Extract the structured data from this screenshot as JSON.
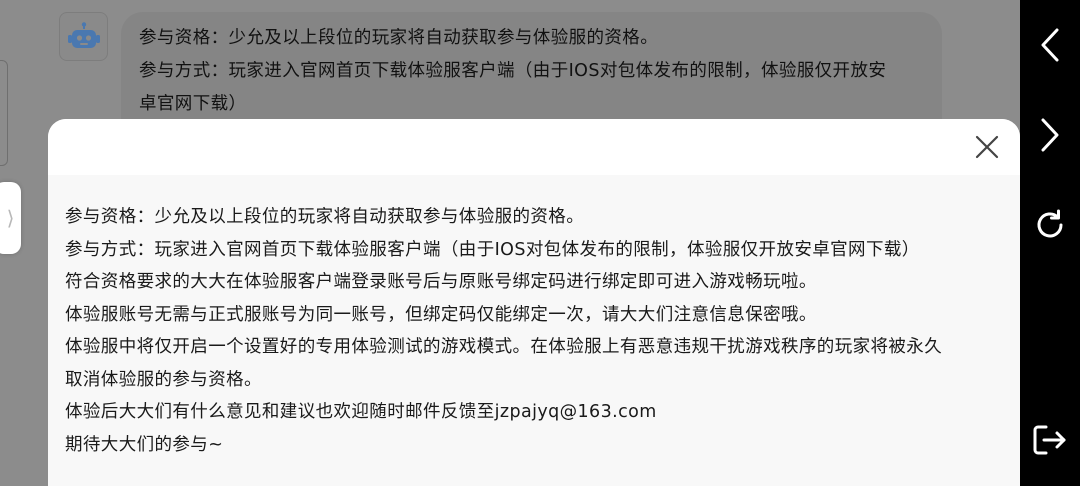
{
  "chat": {
    "bubble_lines": [
      "参与资格：少允及以上段位的玩家将自动获取参与体验服的资格。",
      "参与方式：玩家进入官网首页下载体验服客户端（由于IOS对包体发布的限制，体验服仅开放安",
      "卓官网下载）"
    ]
  },
  "modal": {
    "lines": [
      "参与资格：少允及以上段位的玩家将自动获取参与体验服的资格。",
      "参与方式：玩家进入官网首页下载体验服客户端（由于IOS对包体发布的限制，体验服仅开放安卓官网下载）",
      "符合资格要求的大大在体验服客户端登录账号后与原账号绑定码进行绑定即可进入游戏畅玩啦。",
      "体验服账号无需与正式服账号为同一账号，但绑定码仅能绑定一次，请大大们注意信息保密哦。",
      "体验服中将仅开启一个设置好的专用体验测试的游戏模式。在体验服上有恶意违规干扰游戏秩序的玩家将被永久",
      "取消体验服的参与资格。",
      "体验后大大们有什么意见和建议也欢迎随时邮件反馈至jzpajyq@163.com",
      "期待大大们的参与~"
    ]
  },
  "handle": {
    "glyph": "⟩"
  },
  "icons": {
    "bot_avatar": "robot-icon",
    "close": "close-icon",
    "back": "chevron-left-icon",
    "forward": "chevron-right-icon",
    "reload": "refresh-icon",
    "exit": "exit-icon"
  },
  "colors": {
    "overlay": "#8c8c8c",
    "modal_header": "#ffffff",
    "modal_body": "#f8f8f8",
    "robot_blue": "#4a78b0",
    "nav_bg": "#000000"
  }
}
